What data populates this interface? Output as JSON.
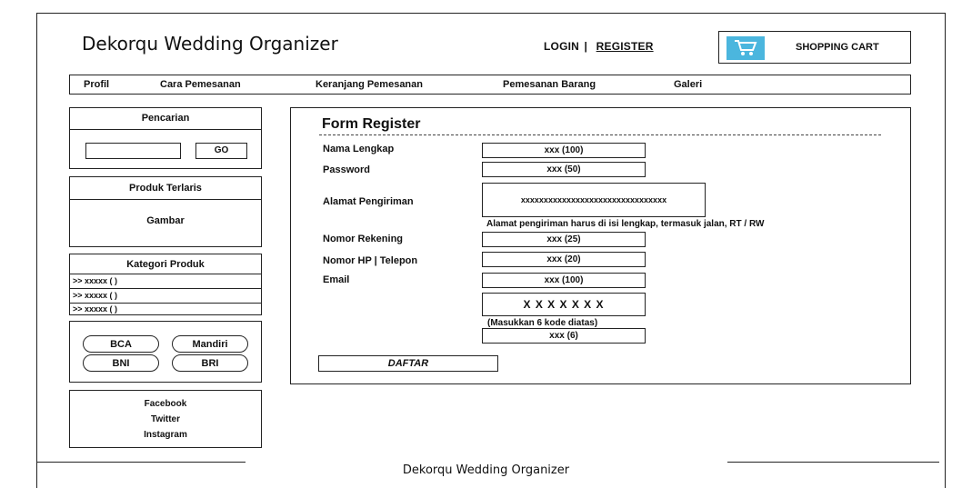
{
  "header": {
    "site_title": "Dekorqu Wedding Organizer",
    "login_label": "LOGIN",
    "separator": "|",
    "register_label": "REGISTER",
    "cart_label": "SHOPPING CART",
    "cart_icon": "shopping-cart-icon",
    "cart_icon_color": "#4bb6de"
  },
  "nav": {
    "items": [
      "Profil",
      "Cara Pemesanan",
      "Keranjang Pemesanan",
      "Pemesanan Barang",
      "Galeri"
    ]
  },
  "sidebar": {
    "search": {
      "title": "Pencarian",
      "input_value": "",
      "go_label": "GO"
    },
    "bestseller": {
      "title": "Produk Terlaris",
      "image_label": "Gambar"
    },
    "categories": {
      "title": "Kategori Produk",
      "items": [
        ">> xxxxx ( )",
        ">> xxxxx ( )",
        ">> xxxxx ( )"
      ]
    },
    "banks": [
      "BCA",
      "Mandiri",
      "BNI",
      "BRI"
    ],
    "social": [
      "Facebook",
      "Twitter",
      "Instagram"
    ]
  },
  "form": {
    "title": "Form Register",
    "fields": {
      "name": {
        "label": "Nama Lengkap",
        "value": "xxx (100)"
      },
      "password": {
        "label": "Password",
        "value": "xxx (50)"
      },
      "address": {
        "label": "Alamat Pengiriman",
        "value": "xxxxxxxxxxxxxxxxxxxxxxxxxxxxxxxx",
        "note": "Alamat  pengiriman harus di isi lengkap, termasuk jalan, RT / RW"
      },
      "account": {
        "label": "Nomor Rekening",
        "value": "xxx (25)"
      },
      "phone": {
        "label": "Nomor HP | Telepon",
        "value": "xxx (20)"
      },
      "email": {
        "label": "Email",
        "value": "xxx (100)"
      }
    },
    "captcha": {
      "code": "X X X X X X X",
      "hint": "(Masukkan 6 kode diatas)",
      "value": "xxx (6)"
    },
    "submit_label": "DAFTAR"
  },
  "footer": {
    "text": "Dekorqu Wedding Organizer"
  }
}
